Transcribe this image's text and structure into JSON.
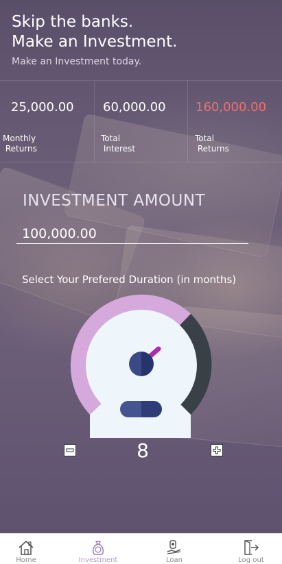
{
  "hero": {
    "title_line1": "Skip the banks.",
    "title_line2": "Make an Investment.",
    "subtitle": "Make an Investment today."
  },
  "stats": [
    {
      "value": "25,000.00",
      "label": "Monthly\n Returns"
    },
    {
      "value": "60,000.00",
      "label": "Total\n Interest"
    },
    {
      "value": "160,000.00",
      "label": "Total\n Returns",
      "color": "#ef6f6f"
    }
  ],
  "investment": {
    "label": "INVESTMENT AMOUNT",
    "amount_value": "100,000.00"
  },
  "duration": {
    "label": "Select Your Prefered Duration (in months)",
    "value": "8",
    "gauge_colors": {
      "ring_left": "#d5a9dc",
      "ring_right": "#3a4048",
      "face": "#eef5fb",
      "needle": "#b02ab0",
      "hub": "#2c3e78"
    }
  },
  "tabbar": {
    "items": [
      {
        "label": "Home",
        "icon": "home-icon"
      },
      {
        "label": "Investment",
        "icon": "money-bag-icon",
        "active": true
      },
      {
        "label": "Loan",
        "icon": "loan-icon"
      },
      {
        "label": "Log out",
        "icon": "logout-icon"
      }
    ]
  }
}
